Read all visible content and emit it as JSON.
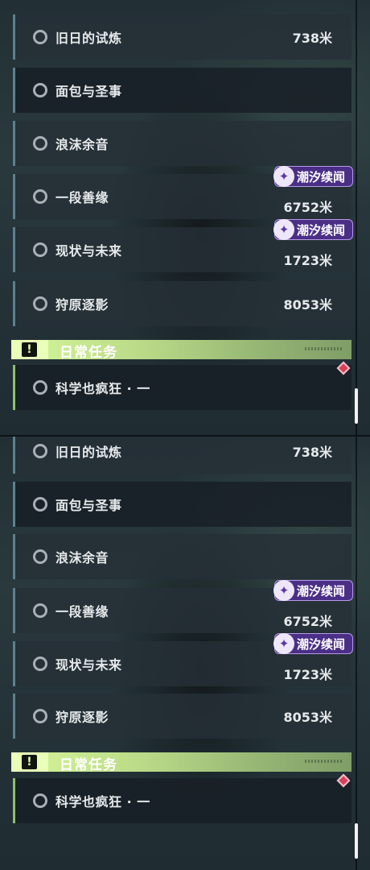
{
  "quests": [
    {
      "name": "旧日的试炼",
      "distance": "738米",
      "badge": ""
    },
    {
      "name": "面包与圣事",
      "distance": "",
      "badge": ""
    },
    {
      "name": "浪沫余音",
      "distance": "",
      "badge": ""
    },
    {
      "name": "一段善缘",
      "distance": "6752米",
      "badge": "潮汐续闻"
    },
    {
      "name": "现状与未来",
      "distance": "1723米",
      "badge": "潮汐续闻"
    },
    {
      "name": "狩原逐影",
      "distance": "8053米",
      "badge": ""
    }
  ],
  "daily_section": {
    "title": "日常任务",
    "icon": "exclamation-icon",
    "quest": {
      "name": "科学也疯狂 · 一"
    }
  },
  "badge_icon": "wave-icon",
  "colors": {
    "accent_green": "#c5e58f",
    "badge_purple": "#4b2f86",
    "marker_red": "#d8405a"
  }
}
